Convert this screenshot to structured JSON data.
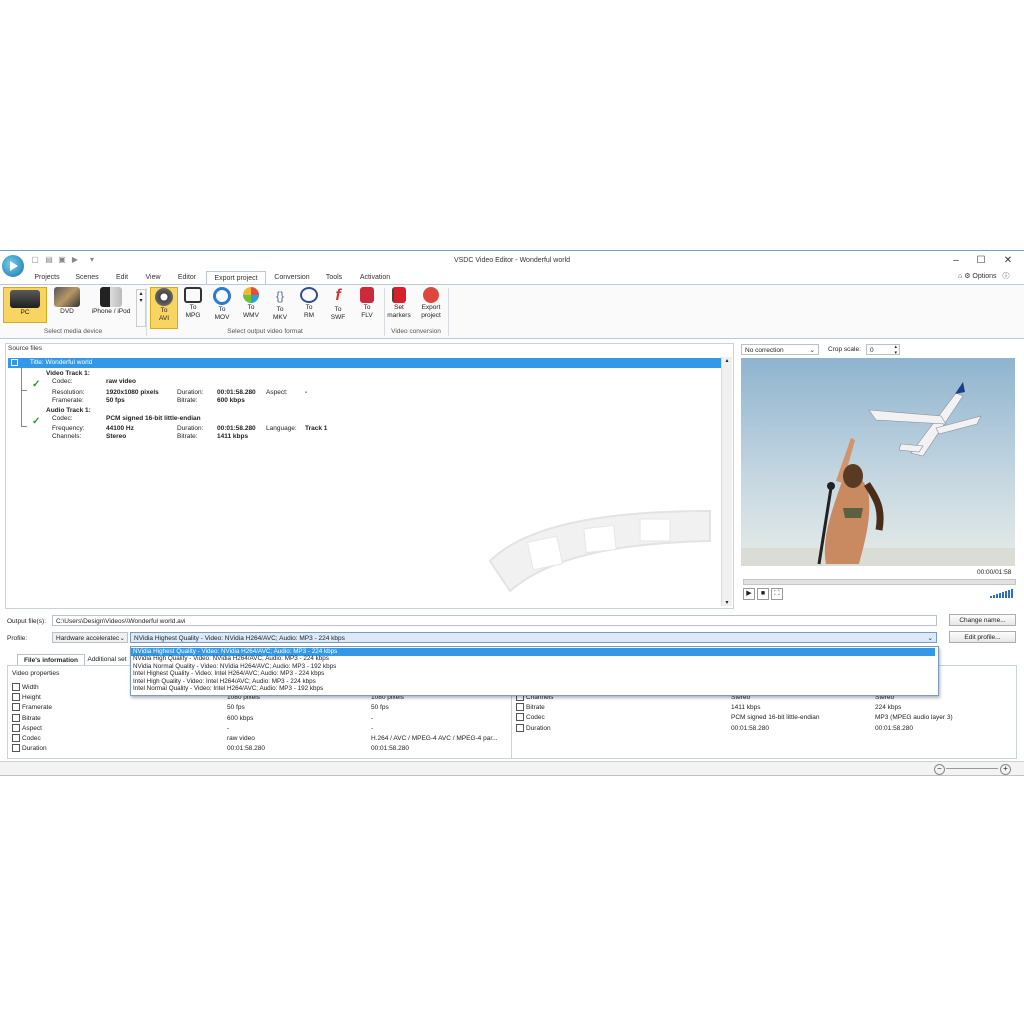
{
  "window": {
    "title": "VSDC Video Editor - Wonderful world"
  },
  "menu": {
    "tabs": [
      "Projects",
      "Scenes",
      "Edit",
      "View",
      "Editor",
      "Export project",
      "Conversion",
      "Tools",
      "Activation"
    ],
    "options": "Options"
  },
  "ribbon": {
    "devices": [
      "PC",
      "DVD",
      "iPhone / iPod"
    ],
    "device_group": "Select media device",
    "formats": [
      {
        "l1": "To",
        "l2": "AVI",
        "icon": "film-reel-icon",
        "color": "#444444"
      },
      {
        "l1": "To",
        "l2": "MPG",
        "icon": "monitor-icon",
        "color": "#333333"
      },
      {
        "l1": "To",
        "l2": "MOV",
        "icon": "quicktime-icon",
        "color": "#2b7bd0"
      },
      {
        "l1": "To",
        "l2": "WMV",
        "icon": "wmv-icon",
        "color": "#2aa1d6"
      },
      {
        "l1": "To",
        "l2": "MKV",
        "icon": "mkv-icon",
        "color": "#5a6a88"
      },
      {
        "l1": "To",
        "l2": "RM",
        "icon": "realmedia-icon",
        "color": "#2f4f88"
      },
      {
        "l1": "To",
        "l2": "SWF",
        "icon": "flash-icon",
        "color": "#d83226"
      },
      {
        "l1": "To",
        "l2": "FLV",
        "icon": "flv-icon",
        "color": "#cc2a3a"
      }
    ],
    "format_group": "Select output video format",
    "conversion": [
      {
        "l1": "Set",
        "l2": "markers"
      },
      {
        "l1": "Export",
        "l2": "project"
      }
    ],
    "conversion_group": "Video conversion"
  },
  "source": {
    "header": "Source files",
    "title_row": "Title: Wonderful world",
    "video_track": {
      "heading": "Video Track 1:",
      "codec_label": "Codec:",
      "codec": "raw video",
      "res_label": "Resolution:",
      "res": "1920x1080 pixels",
      "dur_label": "Duration:",
      "dur": "00:01:58.280",
      "aspect_label": "Aspect:",
      "aspect": "-",
      "fr_label": "Framerate:",
      "fr": "50 fps",
      "br_label": "Bitrate:",
      "br": "600 kbps"
    },
    "audio_track": {
      "heading": "Audio Track 1:",
      "codec_label": "Codec:",
      "codec": "PCM signed 16-bit little-endian",
      "freq_label": "Frequency:",
      "freq": "44100 Hz",
      "dur_label": "Duration:",
      "dur": "00:01:58.280",
      "lang_label": "Language:",
      "lang": "Track 1",
      "ch_label": "Channels:",
      "ch": "Stereo",
      "br_label": "Bitrate:",
      "br": "1411 kbps"
    }
  },
  "preview": {
    "correction": "No correction",
    "crop_label": "Crop scale:",
    "crop_value": "0",
    "time": "00:00/01:58"
  },
  "output": {
    "label": "Output file(s):",
    "path": "C:\\Users\\Design\\Videos\\\\Wonderful world.avi",
    "change_btn": "Change name...",
    "profile_label": "Profile:",
    "profile_type": "Hardware acceleratec",
    "profile_value": "NVidia Highest Quality - Video: NVidia H264/AVC; Audio: MP3 - 224 kbps",
    "edit_btn": "Edit profile..."
  },
  "dropdown": [
    "NVidia Highest Quality - Video: NVidia H264/AVC; Audio: MP3 - 224 kbps",
    "NVidia High Quality - Video: NVidia H264/AVC; Audio: MP3 - 224 kbps",
    "NVidia Normal Quality - Video: NVidia H264/AVC; Audio: MP3 - 192 kbps",
    "Intel Highest Quality - Video: Intel H264/AVC; Audio: MP3 - 224 kbps",
    "Intel High Quality - Video: Intel H264/AVC; Audio: MP3 - 224 kbps",
    "Intel Normal Quality - Video: Intel H264/AVC; Audio: MP3 - 192 kbps"
  ],
  "info_tabs": [
    "File's information",
    "Additional set"
  ],
  "video_props": {
    "header": "Video properties",
    "rows": [
      {
        "name": "Width",
        "a": "",
        "b": ""
      },
      {
        "name": "Height",
        "a": "1080 pixels",
        "b": "1080 pixels"
      },
      {
        "name": "Framerate",
        "a": "50 fps",
        "b": "50 fps"
      },
      {
        "name": "Bitrate",
        "a": "600 kbps",
        "b": "-"
      },
      {
        "name": "Aspect",
        "a": "-",
        "b": "-"
      },
      {
        "name": "Codec",
        "a": "raw video",
        "b": "H.264 / AVC / MPEG-4 AVC / MPEG-4 par..."
      },
      {
        "name": "Duration",
        "a": "00:01:58.280",
        "b": "00:01:58.280"
      }
    ]
  },
  "audio_props": {
    "rows": [
      {
        "name": "Channels",
        "a": "Stereo",
        "b": "Stereo"
      },
      {
        "name": "Bitrate",
        "a": "1411 kbps",
        "b": "224 kbps"
      },
      {
        "name": "Codec",
        "a": "PCM signed 16-bit little-endian",
        "b": "MP3 (MPEG audio layer 3)"
      },
      {
        "name": "Duration",
        "a": "00:01:58.280",
        "b": "00:01:58.280"
      }
    ]
  }
}
